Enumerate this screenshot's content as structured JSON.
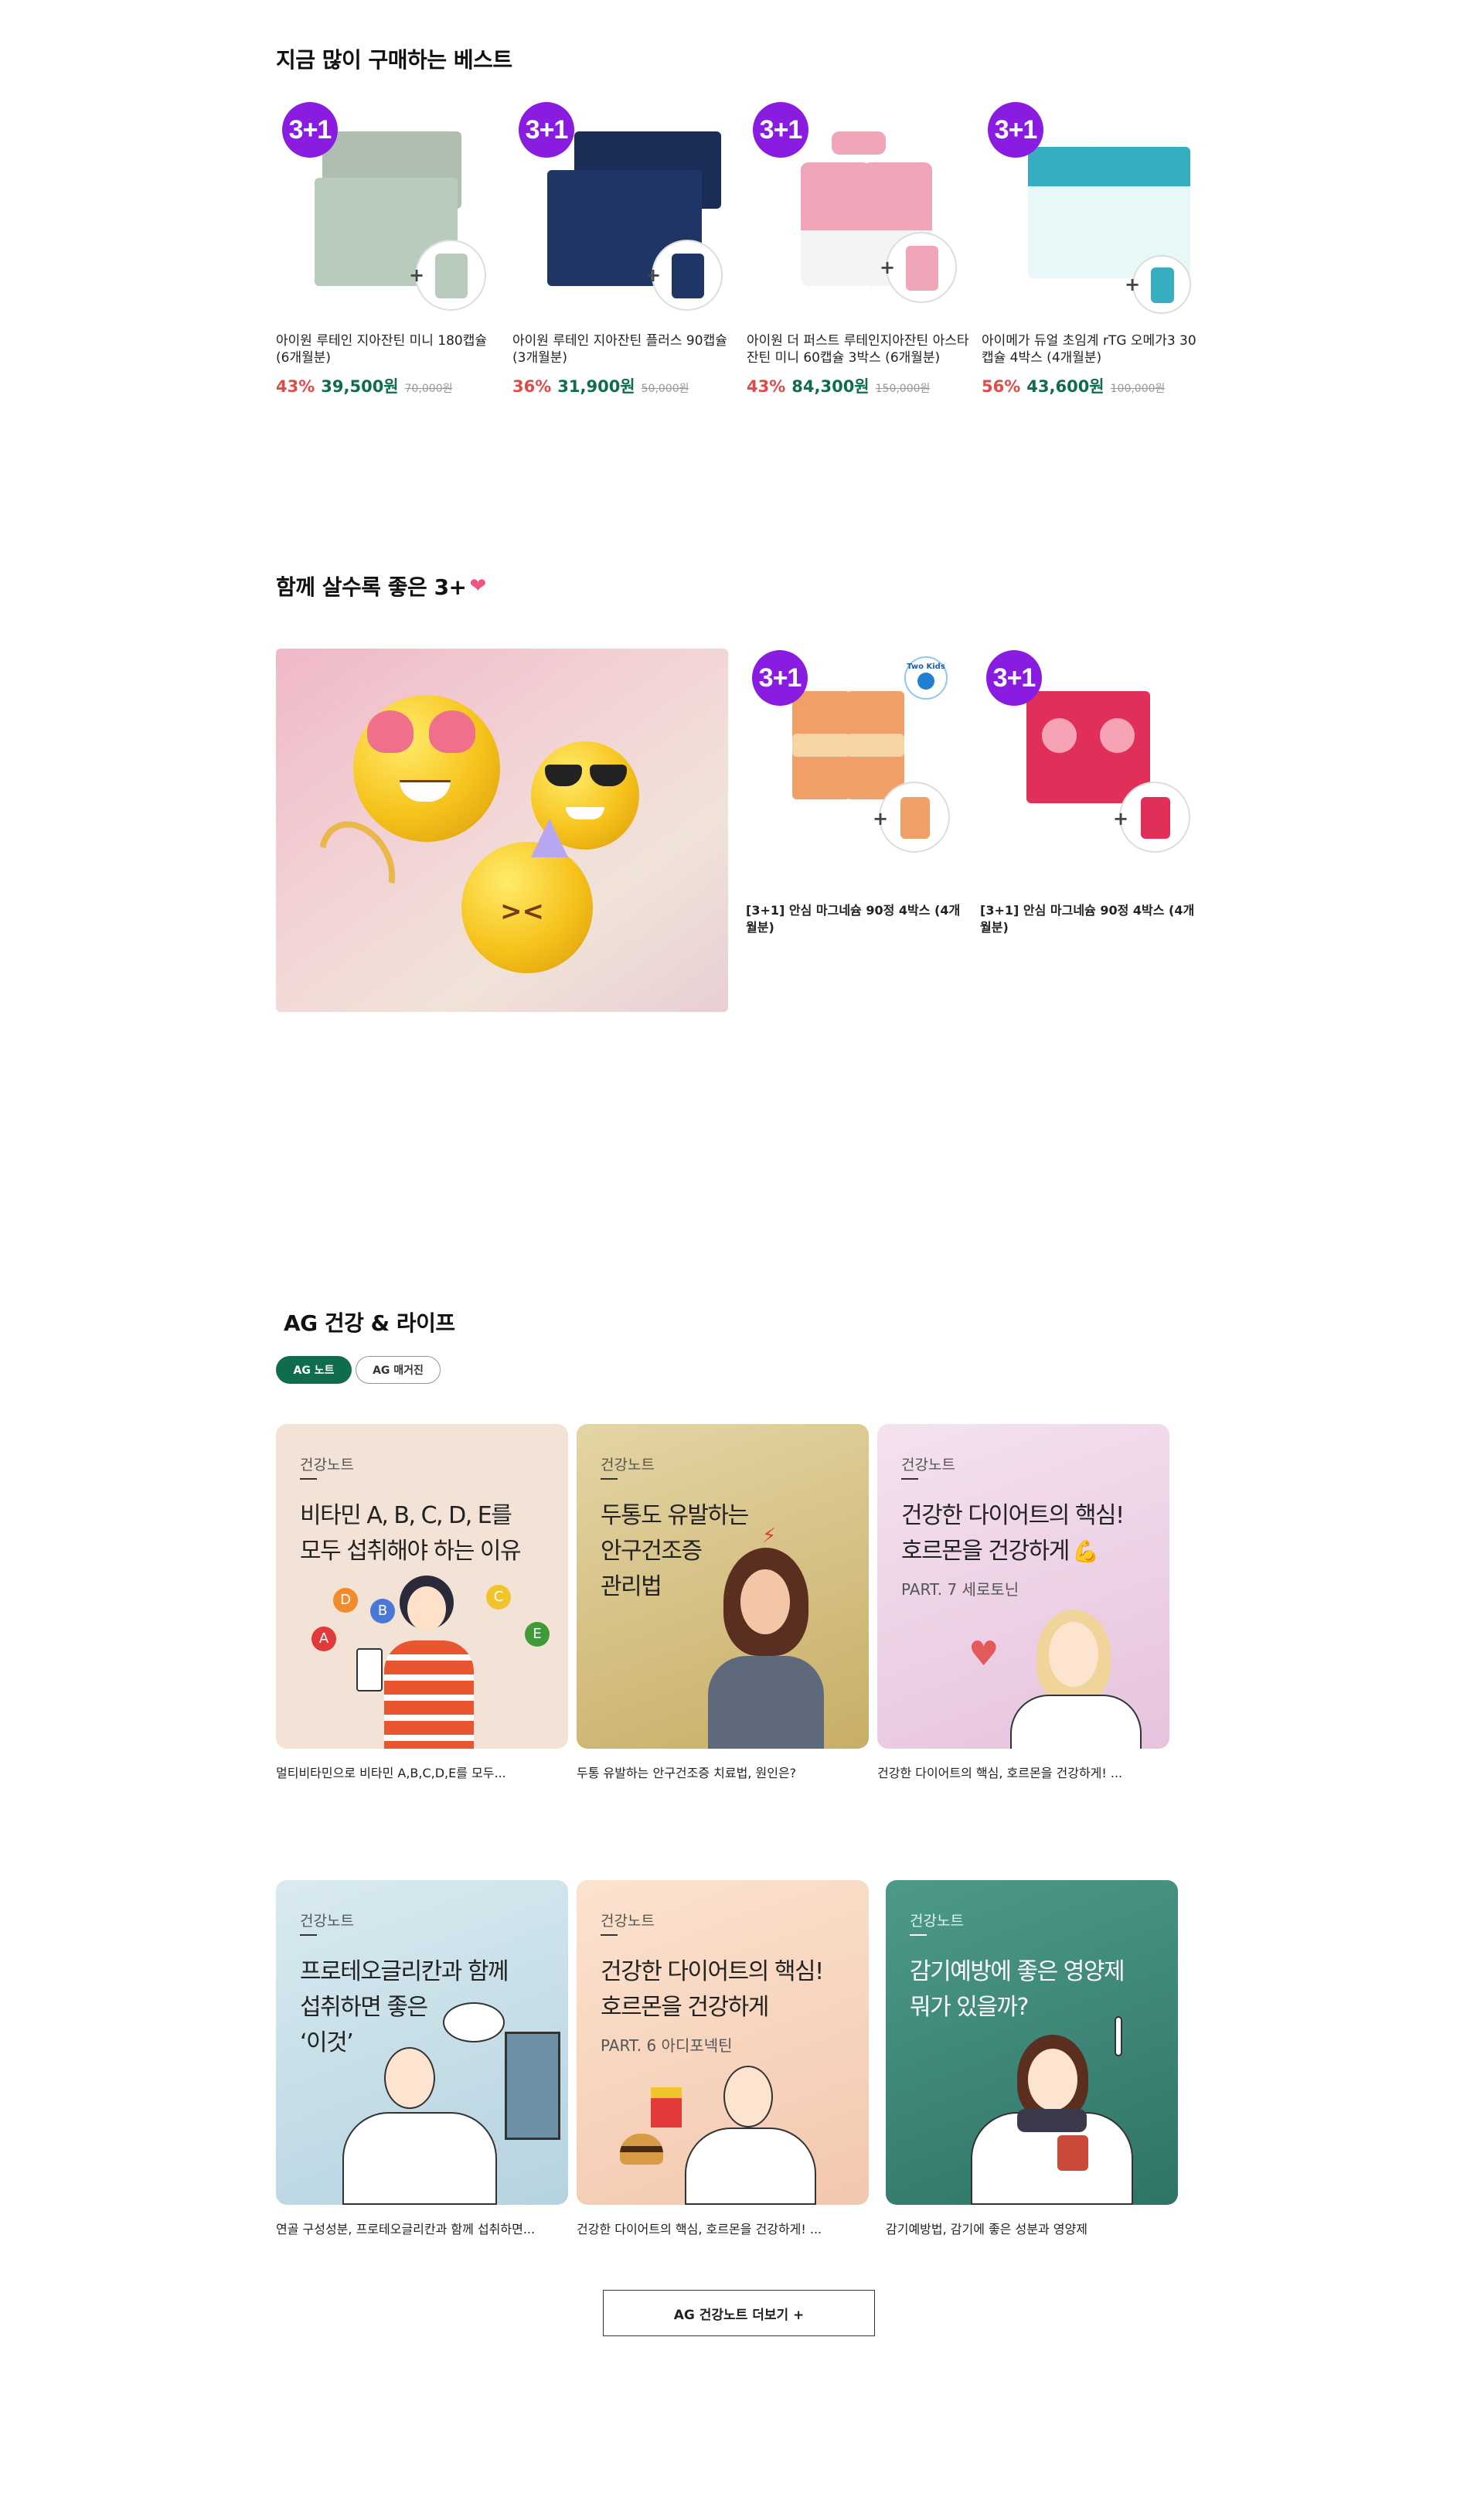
{
  "best": {
    "title": "지금 많이 구매하는 베스트",
    "products": [
      {
        "badge": "3+1",
        "name": "아이원 루테인 지아잔틴 미니 180캡슐 (6개월분)",
        "discount": "43%",
        "price": "39,500원",
        "original": "70,000원",
        "box_color": "#b9cbbd"
      },
      {
        "badge": "3+1",
        "name": "아이원 루테인 지아잔틴 플러스 90캡슐 (3개월분)",
        "discount": "36%",
        "price": "31,900원",
        "original": "50,000원",
        "box_color": "#1f3566"
      },
      {
        "badge": "3+1",
        "name": "아이원 더 퍼스트 루테인지아잔틴 아스타잔틴 미니 60캡슐 3박스 (6개월분)",
        "discount": "43%",
        "price": "84,300원",
        "original": "150,000원",
        "box_color": "#f0a6b8"
      },
      {
        "badge": "3+1",
        "name": "아이메가 듀얼 초임계 rTG 오메가3 30캡슐 4박스 (4개월분)",
        "discount": "56%",
        "price": "43,600원",
        "original": "100,000원",
        "box_color": "#37aebf"
      }
    ]
  },
  "together": {
    "title": "함께 살수록 좋은 3+",
    "heart": "❤",
    "products": [
      {
        "badge": "3+1",
        "name": "[3+1] 안심 마그네슘 90정 4박스 (4개월분)",
        "box_color": "#f0a066",
        "tag": "Two Kids"
      },
      {
        "badge": "3+1",
        "name": "[3+1] 안심 마그네슘 90정 4박스 (4개월분)",
        "box_color": "#e0305a"
      }
    ]
  },
  "health": {
    "title": "AG 건강 & 라이프",
    "tabs": [
      {
        "label": "AG 노트",
        "active": true
      },
      {
        "label": "AG 매거진",
        "active": false
      }
    ],
    "notes": [
      {
        "category": "건강노트",
        "headline": "비타민 A, B, C, D, E를\n모두 섭취해야 하는 이유",
        "sub": "",
        "caption": "멀티비타민으로 비타민 A,B,C,D,E를 모두...",
        "bg": "#f3e3d6"
      },
      {
        "category": "건강노트",
        "headline": "두통도 유발하는\n안구건조증\n관리법",
        "sub": "",
        "caption": "두통 유발하는 안구건조증 치료법, 원인은?",
        "bg": "#d9c68f"
      },
      {
        "category": "건강노트",
        "headline": "건강한 다이어트의 핵심!\n호르몬을 건강하게",
        "sub": "PART. 7 세로토닌",
        "caption": "건강한 다이어트의 핵심, 호르몬을 건강하게! ...",
        "bg": "#efd8ea"
      },
      {
        "category": "건강노트",
        "headline": "프로테오글리칸과 함께\n섭취하면 좋은\n‘이것’",
        "sub": "",
        "caption": "연골 구성성분, 프로테오글리칸과 함께 섭취하면...",
        "bg": "#cfe3ec"
      },
      {
        "category": "건강노트",
        "headline": "건강한 다이어트의 핵심!\n호르몬을 건강하게",
        "sub": "PART. 6 아디포넥틴",
        "caption": "건강한 다이어트의 핵심, 호르몬을 건강하게! ...",
        "bg": "#f6d6c3"
      },
      {
        "category": "건강노트",
        "headline": "감기예방에 좋은 영양제\n뭐가 있을까?",
        "sub": "",
        "caption": "감기예방법, 감기에 좋은 성분과 영양제",
        "bg": "#3f8b7c"
      }
    ],
    "more_button": "AG 건강노트 더보기 +"
  }
}
